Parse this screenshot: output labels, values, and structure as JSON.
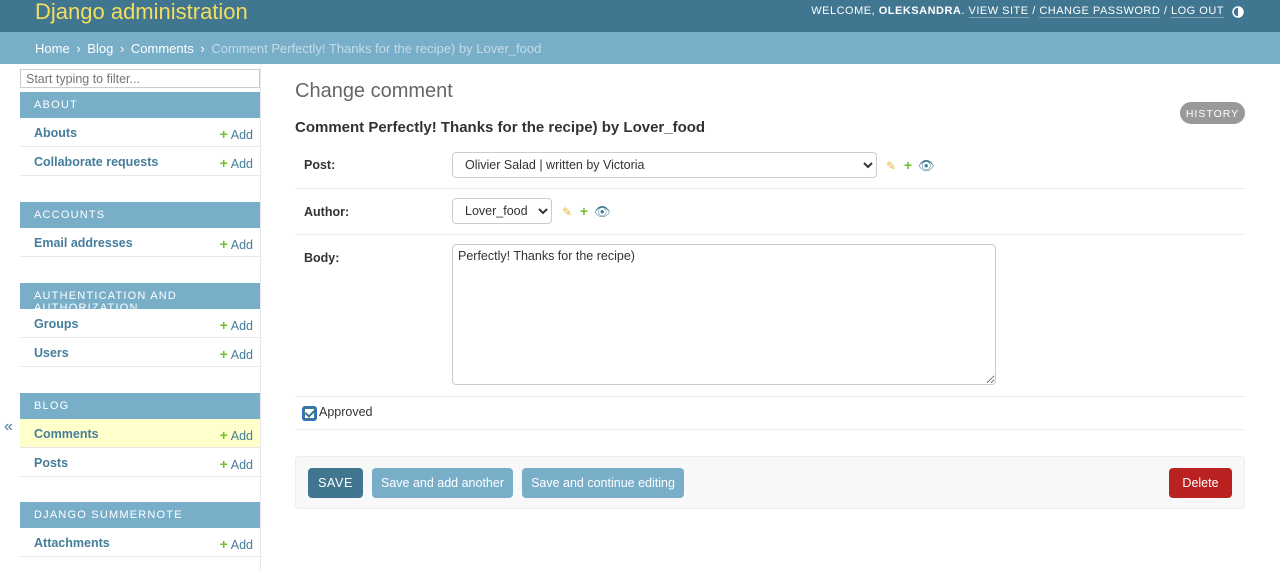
{
  "header": {
    "brand": "Django administration",
    "welcome": "Welcome,",
    "username": "Oleksandra",
    "view_site": "View site",
    "change_password": "Change password",
    "log_out": "Log out",
    "separator": "/",
    "theme_icon": "contrast-half-circle-icon",
    "colors": {
      "bar": "#417690",
      "brand": "#f5dd5d"
    }
  },
  "breadcrumbs": {
    "home": "Home",
    "blog": "Blog",
    "comments": "Comments",
    "current": "Comment Perfectly! Thanks for the recipe) by Lover_food",
    "arrow": "›"
  },
  "sidebar": {
    "filter_placeholder": "Start typing to filter...",
    "add_label": "Add",
    "collapse_glyph": "«",
    "modules": [
      {
        "caption": "About",
        "models": [
          {
            "name": "Abouts"
          },
          {
            "name": "Collaborate requests"
          }
        ]
      },
      {
        "caption": "Accounts",
        "models": [
          {
            "name": "Email addresses"
          }
        ]
      },
      {
        "caption": "Authentication and Authorization",
        "models": [
          {
            "name": "Groups"
          },
          {
            "name": "Users"
          }
        ]
      },
      {
        "caption": "Blog",
        "models": [
          {
            "name": "Comments",
            "current": true
          },
          {
            "name": "Posts"
          }
        ]
      },
      {
        "caption": "Django Summernote",
        "models": [
          {
            "name": "Attachments"
          }
        ]
      }
    ]
  },
  "content": {
    "title": "Change comment",
    "history": "History",
    "object_title": "Comment Perfectly! Thanks for the recipe) by Lover_food",
    "fields": {
      "post": {
        "label": "Post:",
        "value": "Olivier Salad | written by Victoria"
      },
      "author": {
        "label": "Author:",
        "value": "Lover_food"
      },
      "body": {
        "label": "Body:",
        "value": "Perfectly! Thanks for the recipe)"
      },
      "approved": {
        "label": "Approved",
        "checked": true
      }
    },
    "related_icons": [
      "pencil-icon",
      "plus-icon",
      "eye-icon"
    ]
  },
  "submit_row": {
    "save": "Save",
    "save_add_another": "Save and add another",
    "save_continue": "Save and continue editing",
    "delete": "Delete",
    "colors": {
      "primary": "#417690",
      "secondary": "#79aec8",
      "delete": "#ba2121"
    }
  }
}
